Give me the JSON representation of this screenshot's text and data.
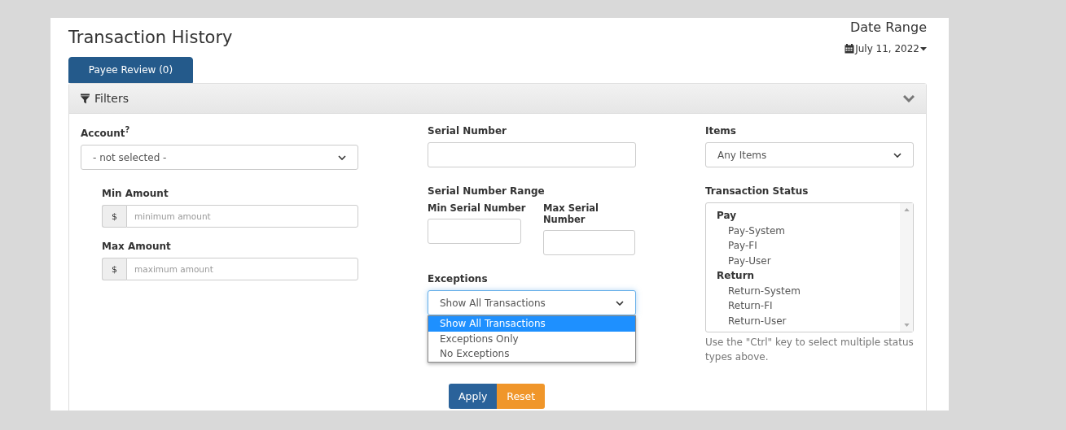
{
  "page": {
    "title": "Transaction History",
    "date_range": {
      "label": "Date Range",
      "value": "July 11, 2022"
    },
    "tabs": [
      {
        "label": "Payee Review (0)",
        "selected": true
      }
    ]
  },
  "filters": {
    "title": "Filters",
    "expanded": true,
    "account": {
      "label": "Account$^{?}$",
      "value": "- not selected -"
    },
    "min_amount": {
      "label": "Min Amount",
      "prefix": "$",
      "placeholder": "minimum amount"
    },
    "max_amount": {
      "label": "Max Amount",
      "prefix": "$",
      "placeholder": "maximum amount"
    },
    "serial_number": {
      "label": "Serial Number"
    },
    "serial_range": {
      "label": "Serial Number Range",
      "min_label": "Min Serial Number",
      "max_label": "Max Serial Number"
    },
    "exceptions": {
      "label": "Exceptions",
      "value": "Show All Transactions",
      "open": true,
      "options": [
        {
          "label": "Show All Transactions",
          "selected": true
        },
        {
          "label": "Exceptions Only",
          "selected": false
        },
        {
          "label": "No Exceptions",
          "selected": false
        }
      ]
    },
    "items": {
      "label": "Items",
      "value": "Any Items"
    },
    "transaction_status": {
      "label": "Transaction Status",
      "groups": [
        {
          "label": "Pay",
          "children": [
            {
              "label": "Pay-System"
            },
            {
              "label": "Pay-FI"
            },
            {
              "label": "Pay-User"
            }
          ]
        },
        {
          "label": "Return",
          "children": [
            {
              "label": "Return-System"
            },
            {
              "label": "Return-FI"
            },
            {
              "label": "Return-User"
            }
          ]
        }
      ],
      "help": "Use the \"Ctrl\" key to select multiple status types above."
    },
    "buttons": [
      {
        "label": "Apply",
        "kind": "primary"
      },
      {
        "label": "Reset",
        "kind": "warning"
      }
    ]
  }
}
